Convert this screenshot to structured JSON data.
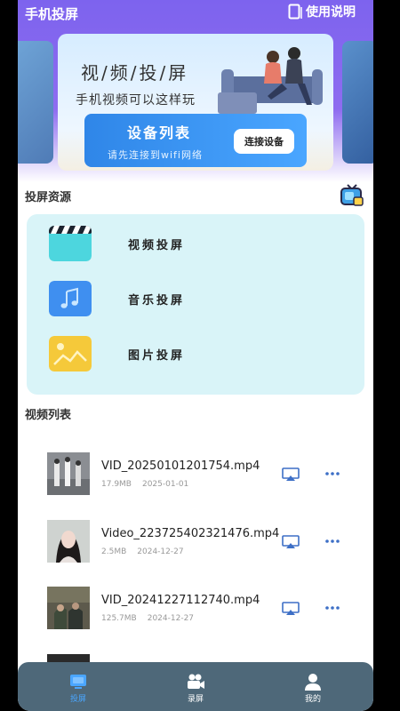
{
  "header": {
    "app_title": "手机投屏",
    "help_label": "使用说明"
  },
  "banner": {
    "title": "视/频/投/屏",
    "subtitle": "手机视频可以这样玩",
    "device_list_title": "设备列表",
    "device_list_hint": "请先连接到wifi网络",
    "connect_button": "连接设备"
  },
  "resources": {
    "section_title": "投屏资源",
    "items": [
      {
        "label": "视频投屏",
        "icon": "clapperboard-icon",
        "color": "#4dd6de"
      },
      {
        "label": "音乐投屏",
        "icon": "music-note-icon",
        "color": "#3f8ff0"
      },
      {
        "label": "图片投屏",
        "icon": "image-icon",
        "color": "#f5c93a"
      }
    ]
  },
  "videos": {
    "section_title": "视频列表",
    "items": [
      {
        "name": "VID_20250101201754.mp4",
        "size": "17.9MB",
        "date": "2025-01-01"
      },
      {
        "name": "Video_223725402321476.mp4",
        "size": "2.5MB",
        "date": "2024-12-27"
      },
      {
        "name": "VID_20241227112740.mp4",
        "size": "125.7MB",
        "date": "2024-12-27"
      }
    ]
  },
  "tabbar": {
    "tabs": [
      {
        "label": "投屏",
        "icon": "cast-tv-icon",
        "active": true
      },
      {
        "label": "录屏",
        "icon": "video-camera-icon",
        "active": false
      },
      {
        "label": "我的",
        "icon": "user-icon",
        "active": false
      }
    ]
  },
  "colors": {
    "header_purple": "#7d63ee",
    "accent_blue": "#2f86e8",
    "panel_cyan": "#d9f4f8",
    "tabbar": "#4e6879"
  }
}
